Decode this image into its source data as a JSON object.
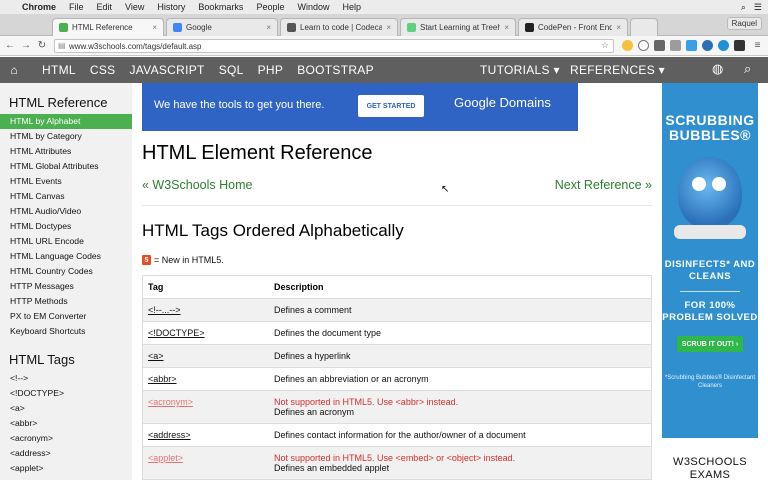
{
  "os_menu": {
    "apple": "",
    "items": [
      "Chrome",
      "File",
      "Edit",
      "View",
      "History",
      "Bookmarks",
      "People",
      "Window",
      "Help"
    ],
    "search": "⌕",
    "list": "☰"
  },
  "tabs": [
    {
      "title": "HTML Reference",
      "color": "#4CAF50"
    },
    {
      "title": "Google",
      "color": "#4285f4"
    },
    {
      "title": "Learn to code | Codecadem",
      "color": "#555555"
    },
    {
      "title": "Start Learning at Treehous",
      "color": "#5fcf80"
    },
    {
      "title": "CodePen - Front End Devel",
      "color": "#222222"
    }
  ],
  "profile": "Raquel",
  "address": {
    "url": "www.w3schools.com/tags/default.asp"
  },
  "topnav": {
    "items": [
      "HTML",
      "CSS",
      "JAVASCRIPT",
      "SQL",
      "PHP",
      "BOOTSTRAP"
    ],
    "tutorials": "TUTORIALS ▾",
    "references": "REFERENCES ▾"
  },
  "sidebar": {
    "heading1": "HTML Reference",
    "items1": [
      "HTML by Alphabet",
      "HTML by Category",
      "HTML Attributes",
      "HTML Global Attributes",
      "HTML Events",
      "HTML Canvas",
      "HTML Audio/Video",
      "HTML Doctypes",
      "HTML URL Encode",
      "HTML Language Codes",
      "HTML Country Codes",
      "HTTP Messages",
      "HTTP Methods",
      "PX to EM Converter",
      "Keyboard Shortcuts"
    ],
    "heading2": "HTML Tags",
    "items2": [
      "<!-->",
      "<!DOCTYPE>",
      "<a>",
      "<abbr>",
      "<acronym>",
      "<address>",
      "<applet>"
    ]
  },
  "ad_banner": {
    "text": "We have the tools to get you there.",
    "button": "GET STARTED",
    "brand": "Google Domains"
  },
  "main": {
    "title": "HTML Element Reference",
    "prev": "« W3Schools Home",
    "next": "Next Reference »",
    "subtitle": "HTML Tags Ordered Alphabetically",
    "html5_badge": "5",
    "html5_note": "= New in HTML5."
  },
  "table": {
    "headers": [
      "Tag",
      "Description"
    ],
    "rows": [
      {
        "tag": "<!--...-->",
        "desc": "Defines a comment",
        "warn": "",
        "deprecated": false
      },
      {
        "tag": "<!DOCTYPE>",
        "desc": "Defines the document type",
        "warn": "",
        "deprecated": false
      },
      {
        "tag": "<a>",
        "desc": "Defines a hyperlink",
        "warn": "",
        "deprecated": false
      },
      {
        "tag": "<abbr>",
        "desc": "Defines an abbreviation or an acronym",
        "warn": "",
        "deprecated": false
      },
      {
        "tag": "<acronym>",
        "desc": "Defines an acronym",
        "warn": "Not supported in HTML5. Use <abbr> instead.",
        "deprecated": true
      },
      {
        "tag": "<address>",
        "desc": "Defines contact information for the author/owner of a document",
        "warn": "",
        "deprecated": false
      },
      {
        "tag": "<applet>",
        "desc": "Defines an embedded applet",
        "warn": "Not supported in HTML5. Use <embed> or <object> instead.",
        "deprecated": true
      }
    ]
  },
  "right_ad": {
    "brand": "SCRUBBING BUBBLES®",
    "line1": "DISINFECTS* AND CLEANS",
    "line2": "FOR 100% PROBLEM SOLVED",
    "cta": "SCRUB IT OUT! ›",
    "fine": "*Scrubbing Bubbles® Disinfectant Cleaners"
  },
  "exams": "W3SCHOOLS EXAMS"
}
